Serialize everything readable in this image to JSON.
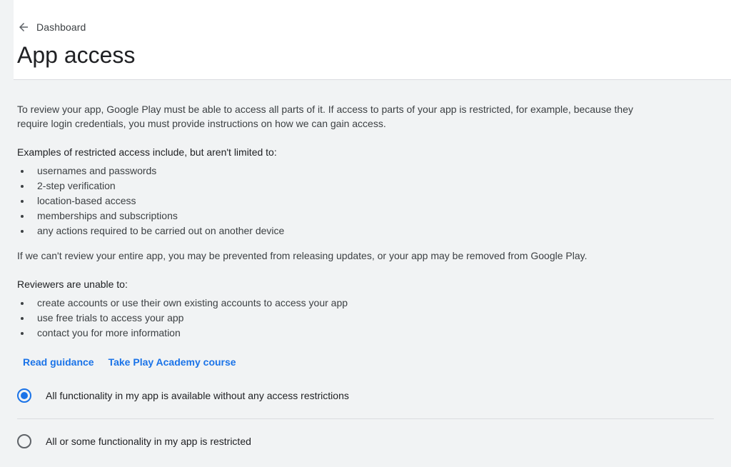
{
  "header": {
    "back_label": "Dashboard",
    "title": "App access"
  },
  "main": {
    "intro": "To review your app, Google Play must be able to access all parts of it. If access to parts of your app is restricted, for example, because they require login credentials, you must provide instructions on how we can gain access.",
    "examples_heading": "Examples of restricted access include, but aren't limited to:",
    "examples": [
      "usernames and passwords",
      "2-step verification",
      "location-based access",
      "memberships and subscriptions",
      "any actions required to be carried out on another device"
    ],
    "warning": "If we can't review your entire app, you may be prevented from releasing updates, or your app may be removed from Google Play.",
    "reviewers_heading": "Reviewers are unable to:",
    "reviewers": [
      "create accounts or use their own existing accounts to access your app",
      "use free trials to access your app",
      "contact you for more information"
    ],
    "links": {
      "read_guidance": "Read guidance",
      "academy_course": "Take Play Academy course"
    },
    "options": [
      {
        "label": "All functionality in my app is available without any access restrictions",
        "selected": true
      },
      {
        "label": "All or some functionality in my app is restricted",
        "selected": false
      }
    ]
  },
  "colors": {
    "accent": "#1a73e8",
    "background": "#f1f3f4",
    "header_bg": "#ffffff"
  },
  "icons": {
    "back": "arrow-left-icon"
  }
}
